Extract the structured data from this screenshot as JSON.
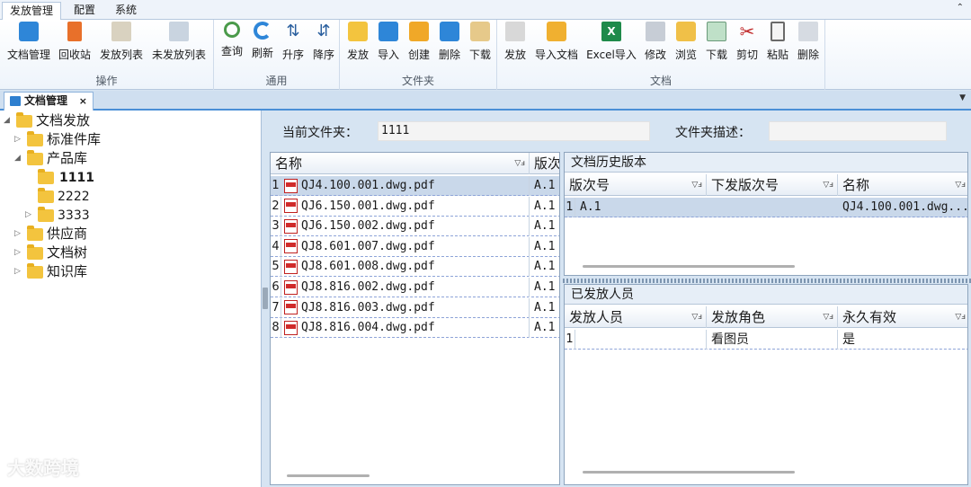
{
  "ribbon_tabs": [
    "发放管理",
    "配置",
    "系统"
  ],
  "ribbon_groups": [
    {
      "label": "操作",
      "buttons": [
        "文档管理",
        "回收站",
        "发放列表",
        "未发放列表"
      ]
    },
    {
      "label": "通用",
      "buttons": [
        "查询",
        "刷新",
        "升序",
        "降序"
      ]
    },
    {
      "label": "文件夹",
      "buttons": [
        "发放",
        "导入",
        "创建",
        "删除",
        "下载"
      ]
    },
    {
      "label": "文档",
      "buttons": [
        "发放",
        "导入文档",
        "Excel导入",
        "修改",
        "浏览",
        "下载",
        "剪切",
        "粘贴",
        "删除"
      ]
    }
  ],
  "icons": {
    "doc_manage": "folder-doc-icon",
    "recycle": "trash-icon",
    "issue_list": "list-icon",
    "unissued_list": "list-pending-icon",
    "query": "magnifier-icon",
    "refresh": "refresh-icon",
    "asc": "sort-asc-icon",
    "desc": "sort-desc-icon",
    "excel": "excel-icon",
    "cut": "scissors-icon",
    "paste": "clipboard-icon"
  },
  "doc_tab": {
    "label": "文档管理",
    "close": "×"
  },
  "tree": {
    "root": "文档发放",
    "nodes": [
      {
        "label": "标准件库",
        "level": 1,
        "expander": "▷"
      },
      {
        "label": "产品库",
        "level": 1,
        "expander": "◢"
      },
      {
        "label": "1111",
        "level": 2,
        "expander": ""
      },
      {
        "label": "2222",
        "level": 2,
        "expander": ""
      },
      {
        "label": "3333",
        "level": 2,
        "expander": "▷"
      },
      {
        "label": "供应商",
        "level": 1,
        "expander": "▷"
      },
      {
        "label": "文档树",
        "level": 1,
        "expander": "▷"
      },
      {
        "label": "知识库",
        "level": 1,
        "expander": "▷"
      }
    ]
  },
  "watermark": "大数跨境",
  "folder_info": {
    "current_label": "当前文件夹：",
    "current_value": "1111",
    "desc_label": "文件夹描述：",
    "desc_value": ""
  },
  "doc_grid": {
    "columns": [
      "名称",
      "版次"
    ],
    "rows": [
      {
        "num": "1",
        "name": "QJ4.100.001.dwg.pdf",
        "ver": "A.1"
      },
      {
        "num": "2",
        "name": "QJ6.150.001.dwg.pdf",
        "ver": "A.1"
      },
      {
        "num": "3",
        "name": "QJ6.150.002.dwg.pdf",
        "ver": "A.1"
      },
      {
        "num": "4",
        "name": "QJ8.601.007.dwg.pdf",
        "ver": "A.1"
      },
      {
        "num": "5",
        "name": "QJ8.601.008.dwg.pdf",
        "ver": "A.1"
      },
      {
        "num": "6",
        "name": "QJ8.816.002.dwg.pdf",
        "ver": "A.1"
      },
      {
        "num": "7",
        "name": "QJ8.816.003.dwg.pdf",
        "ver": "A.1"
      },
      {
        "num": "8",
        "name": "QJ8.816.004.dwg.pdf",
        "ver": "A.1"
      }
    ]
  },
  "history_panel": {
    "title": "文档历史版本",
    "columns": [
      "版次号",
      "下发版次号",
      "名称"
    ],
    "rows": [
      {
        "num": "1",
        "ver": "A.1",
        "issue_ver": "",
        "name": "QJ4.100.001.dwg..."
      }
    ]
  },
  "issued_panel": {
    "title": "已发放人员",
    "columns": [
      "发放人员",
      "发放角色",
      "永久有效"
    ],
    "rows": [
      {
        "num": "1",
        "person": "",
        "role": "看图员",
        "permanent": "是"
      }
    ]
  },
  "filter_glyph": "▽ⅎ"
}
